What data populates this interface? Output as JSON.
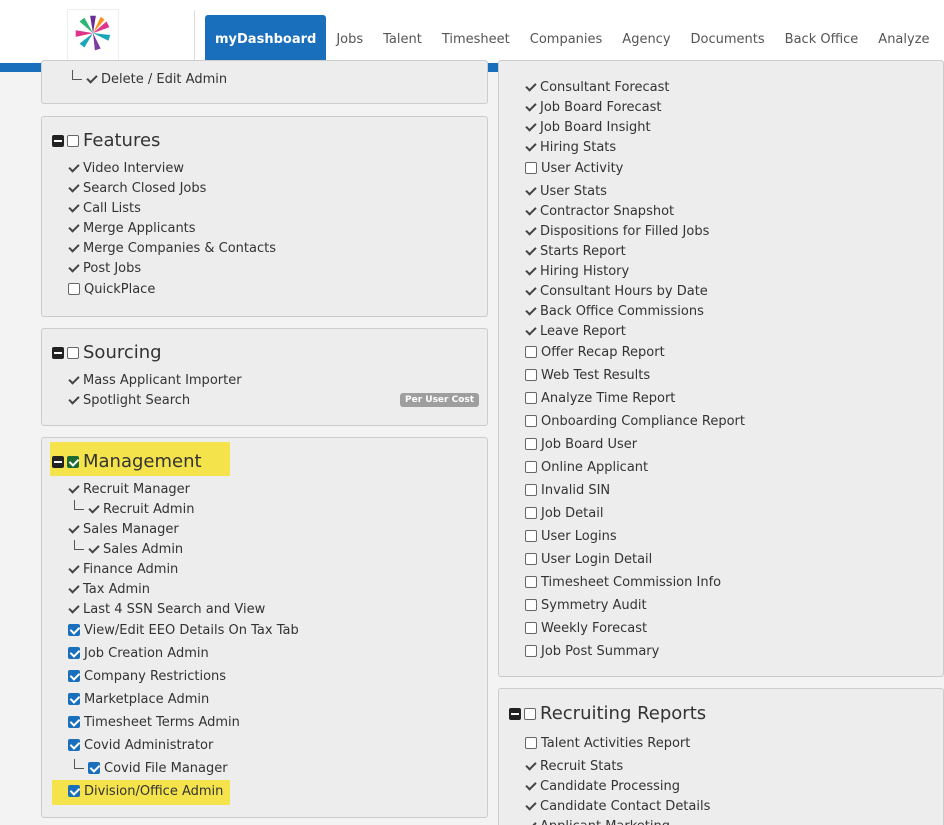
{
  "nav": {
    "tabs": [
      "myDashboard",
      "Jobs",
      "Talent",
      "Timesheet",
      "Companies",
      "Agency",
      "Documents",
      "Back Office",
      "Analyze"
    ],
    "active": "myDashboard"
  },
  "top_panel": {
    "partial_item": "Delete / Edit Admin"
  },
  "features": {
    "title": "Features",
    "items": [
      {
        "label": "Video Interview",
        "state": "tick"
      },
      {
        "label": "Search Closed Jobs",
        "state": "tick"
      },
      {
        "label": "Call Lists",
        "state": "tick"
      },
      {
        "label": "Merge Applicants",
        "state": "tick"
      },
      {
        "label": "Merge Companies & Contacts",
        "state": "tick"
      },
      {
        "label": "Post Jobs",
        "state": "tick"
      },
      {
        "label": "QuickPlace",
        "state": "unchecked"
      }
    ]
  },
  "sourcing": {
    "title": "Sourcing",
    "items": [
      {
        "label": "Mass Applicant Importer",
        "state": "tick"
      },
      {
        "label": "Spotlight Search",
        "state": "tick"
      }
    ],
    "badge": "Per User Cost"
  },
  "management": {
    "title": "Management",
    "items": [
      {
        "label": "Recruit Manager",
        "state": "tick",
        "indent": 0
      },
      {
        "label": "Recruit Admin",
        "state": "tick",
        "indent": 1
      },
      {
        "label": "Sales Manager",
        "state": "tick",
        "indent": 0
      },
      {
        "label": "Sales Admin",
        "state": "tick",
        "indent": 1
      },
      {
        "label": "Finance Admin",
        "state": "tick",
        "indent": 0
      },
      {
        "label": "Tax Admin",
        "state": "tick",
        "indent": 0
      },
      {
        "label": "Last 4 SSN Search and View",
        "state": "tick",
        "indent": 0
      },
      {
        "label": "View/Edit EEO Details On Tax Tab",
        "state": "checked",
        "indent": 0
      },
      {
        "label": "Job Creation Admin",
        "state": "checked",
        "indent": 0
      },
      {
        "label": "Company Restrictions",
        "state": "checked",
        "indent": 0
      },
      {
        "label": "Marketplace Admin",
        "state": "checked",
        "indent": 0
      },
      {
        "label": "Timesheet Terms Admin",
        "state": "checked",
        "indent": 0
      },
      {
        "label": "Covid Administrator",
        "state": "checked",
        "indent": 0
      },
      {
        "label": "Covid File Manager",
        "state": "checked",
        "indent": 1
      },
      {
        "label": "Division/Office Admin",
        "state": "checked",
        "indent": 0
      }
    ]
  },
  "reports_list": {
    "items": [
      {
        "label": "Consultant Forecast",
        "state": "tick"
      },
      {
        "label": "Job Board Forecast",
        "state": "tick"
      },
      {
        "label": "Job Board Insight",
        "state": "tick"
      },
      {
        "label": "Hiring Stats",
        "state": "tick"
      },
      {
        "label": "User Activity",
        "state": "unchecked"
      },
      {
        "label": "User Stats",
        "state": "tick"
      },
      {
        "label": "Contractor Snapshot",
        "state": "tick"
      },
      {
        "label": "Dispositions for Filled Jobs",
        "state": "tick"
      },
      {
        "label": "Starts Report",
        "state": "tick"
      },
      {
        "label": "Hiring History",
        "state": "tick"
      },
      {
        "label": "Consultant Hours by Date",
        "state": "tick"
      },
      {
        "label": "Back Office Commissions",
        "state": "tick"
      },
      {
        "label": "Leave Report",
        "state": "tick"
      },
      {
        "label": "Offer Recap Report",
        "state": "unchecked"
      },
      {
        "label": "Web Test Results",
        "state": "unchecked"
      },
      {
        "label": "Analyze Time Report",
        "state": "unchecked"
      },
      {
        "label": "Onboarding Compliance Report",
        "state": "unchecked"
      },
      {
        "label": "Job Board User",
        "state": "unchecked"
      },
      {
        "label": "Online Applicant",
        "state": "unchecked"
      },
      {
        "label": "Invalid SIN",
        "state": "unchecked"
      },
      {
        "label": "Job Detail",
        "state": "unchecked"
      },
      {
        "label": "User Logins",
        "state": "unchecked"
      },
      {
        "label": "User Login Detail",
        "state": "unchecked"
      },
      {
        "label": "Timesheet Commission Info",
        "state": "unchecked"
      },
      {
        "label": "Symmetry Audit",
        "state": "unchecked"
      },
      {
        "label": "Weekly Forecast",
        "state": "unchecked"
      },
      {
        "label": "Job Post Summary",
        "state": "unchecked"
      }
    ]
  },
  "recruiting_reports": {
    "title": "Recruiting Reports",
    "items": [
      {
        "label": "Talent Activities Report",
        "state": "unchecked"
      },
      {
        "label": "Recruit Stats",
        "state": "tick"
      },
      {
        "label": "Candidate Processing",
        "state": "tick"
      },
      {
        "label": "Candidate Contact Details",
        "state": "tick"
      },
      {
        "label": "Applicant Marketing",
        "state": "tick"
      }
    ]
  },
  "colors": {
    "brand_blue": "#1a6fbd",
    "highlight": "#f4e34a"
  }
}
